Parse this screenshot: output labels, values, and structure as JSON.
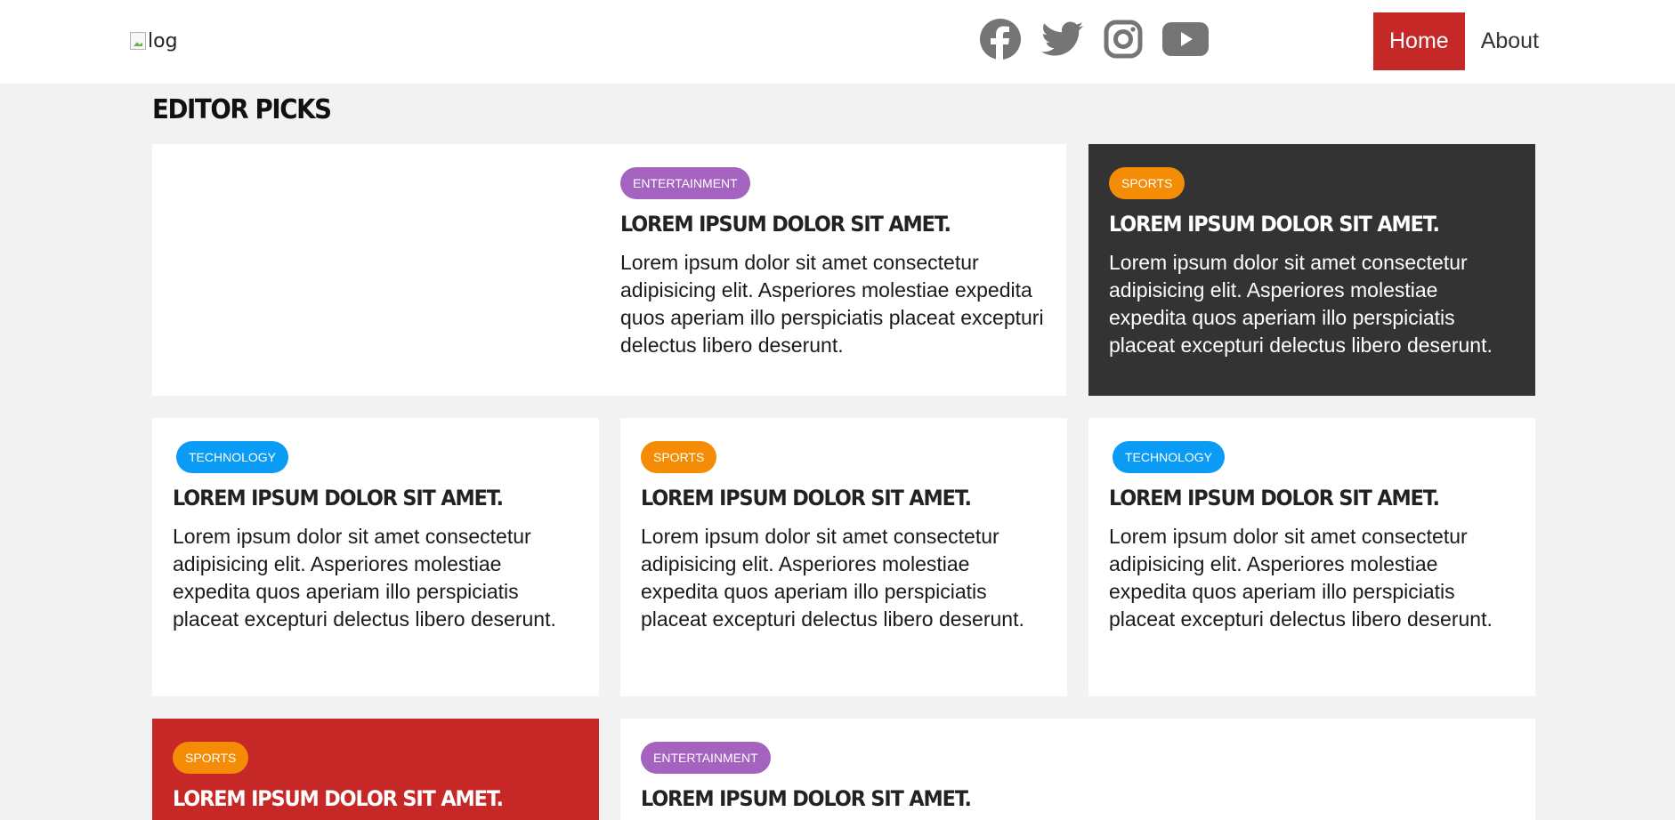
{
  "header": {
    "logo_alt": "log",
    "socials": [
      {
        "icon": "facebook-icon"
      },
      {
        "icon": "twitter-icon"
      },
      {
        "icon": "instagram-icon"
      },
      {
        "icon": "youtube-icon"
      }
    ],
    "nav": [
      {
        "label": "Home",
        "active": true
      },
      {
        "label": "About",
        "active": false
      }
    ]
  },
  "section": {
    "title": "EDITOR PICKS"
  },
  "colors": {
    "accent_red": "#c62828",
    "dark_card": "#333333",
    "entertainment": "#a463bf",
    "sports": "#f48c06",
    "technology": "#0a9cf5",
    "icon_gray": "#757575"
  },
  "cards": [
    {
      "category": "ENTERTAINMENT",
      "title": "LOREM IPSUM DOLOR SIT AMET.",
      "text": "Lorem ipsum dolor sit amet consectetur adipisicing elit. Asperiores molestiae expedita quos aperiam illo perspiciatis placeat excepturi delectus libero deserunt."
    },
    {
      "category": "SPORTS",
      "title": "LOREM IPSUM DOLOR SIT AMET.",
      "text": "Lorem ipsum dolor sit amet consectetur adipisicing elit. Asperiores molestiae expedita quos aperiam illo perspiciatis placeat excepturi delectus libero deserunt."
    },
    {
      "category": "TECHNOLOGY",
      "title": "LOREM IPSUM DOLOR SIT AMET.",
      "text": "Lorem ipsum dolor sit amet consectetur adipisicing elit. Asperiores molestiae expedita quos aperiam illo perspiciatis placeat excepturi delectus libero deserunt."
    },
    {
      "category": "SPORTS",
      "title": "LOREM IPSUM DOLOR SIT AMET.",
      "text": "Lorem ipsum dolor sit amet consectetur adipisicing elit. Asperiores molestiae expedita quos aperiam illo perspiciatis placeat excepturi delectus libero deserunt."
    },
    {
      "category": "TECHNOLOGY",
      "title": "LOREM IPSUM DOLOR SIT AMET.",
      "text": "Lorem ipsum dolor sit amet consectetur adipisicing elit. Asperiores molestiae expedita quos aperiam illo perspiciatis placeat excepturi delectus libero deserunt."
    },
    {
      "category": "SPORTS",
      "title": "LOREM IPSUM DOLOR SIT AMET.",
      "text": ""
    },
    {
      "category": "ENTERTAINMENT",
      "title": "LOREM IPSUM DOLOR SIT AMET.",
      "text": ""
    }
  ]
}
